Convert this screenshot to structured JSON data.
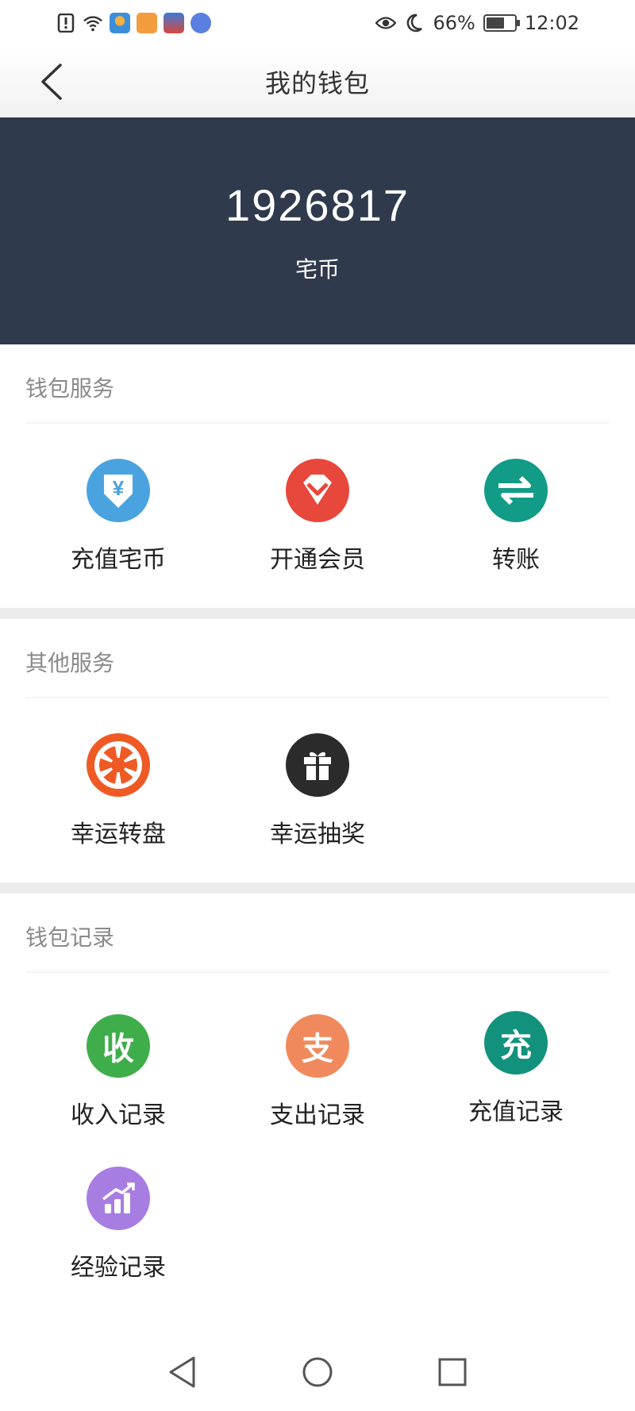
{
  "status_bar": {
    "battery_percent": "66%",
    "battery_level": 0.66,
    "time": "12:02"
  },
  "nav": {
    "title": "我的钱包"
  },
  "balance": {
    "value": "1926817",
    "unit": "宅币",
    "bg_color": "#2f3a4c"
  },
  "wallet_services": {
    "title": "钱包服务",
    "items": [
      {
        "label": "充值宅币",
        "icon": "yen-download-icon",
        "color": "#4aa3df"
      },
      {
        "label": "开通会员",
        "icon": "vip-gem-icon",
        "color": "#e8473b"
      },
      {
        "label": "转账",
        "icon": "transfer-arrows-icon",
        "color": "#129b86"
      }
    ]
  },
  "other_services": {
    "title": "其他服务",
    "items": [
      {
        "label": "幸运转盘",
        "icon": "wheel-icon",
        "color": "#ef5a24"
      },
      {
        "label": "幸运抽奖",
        "icon": "gift-icon",
        "color": "#2b2b2b"
      }
    ]
  },
  "wallet_records": {
    "title": "钱包记录",
    "items": [
      {
        "label": "收入记录",
        "glyph": "收",
        "icon": "income-icon",
        "color": "#3fae4a"
      },
      {
        "label": "支出记录",
        "glyph": "支",
        "icon": "expense-icon",
        "color": "#f08a5d"
      },
      {
        "label": "充值记录",
        "glyph": "充",
        "icon": "recharge-icon",
        "color": "#12927d"
      },
      {
        "label": "经验记录",
        "icon": "experience-chart-icon",
        "color": "#a77de2"
      }
    ]
  }
}
